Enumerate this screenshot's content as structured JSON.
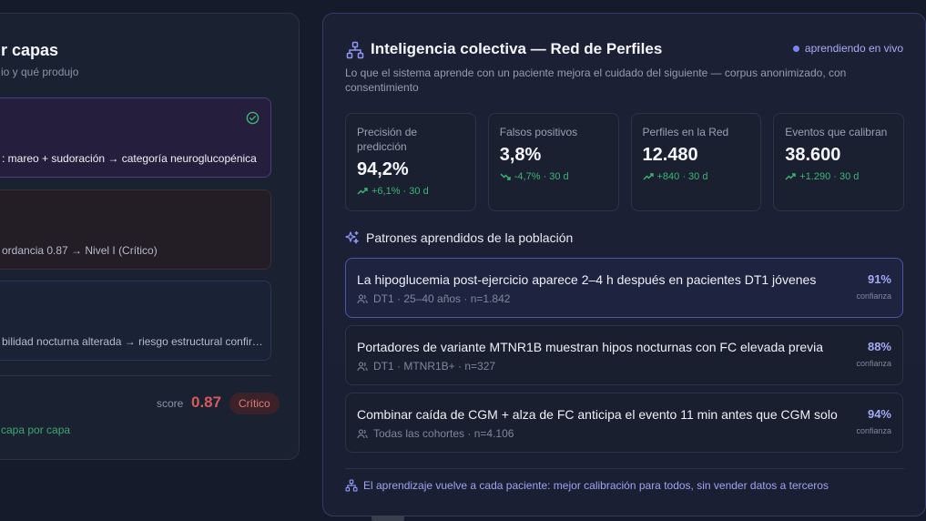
{
  "left_panel": {
    "title": "r capas",
    "subtitle": "io y qué produjo",
    "cards": [
      {
        "text": ": mareo + sudoración → categoría neuroglucopénica"
      },
      {
        "text": "ordancia 0.87 → Nivel I (Crítico)"
      },
      {
        "text": "bilidad nocturna alterada → riesgo estructural confir…"
      }
    ],
    "score_label": "score",
    "score_value": "0.87",
    "badge": "Crítico",
    "footer": "capa por capa"
  },
  "panel": {
    "title": "Inteligencia colectiva — Red de Perfiles",
    "live_label": "aprendiendo en vivo",
    "description": "Lo que el sistema aprende con un paciente mejora el cuidado del siguiente — corpus anonimizado, con consentimiento",
    "metrics": [
      {
        "label": "Precisión de predicción",
        "value": "94,2%",
        "delta": "+6,1% · 30 d",
        "trend": "up"
      },
      {
        "label": "Falsos positivos",
        "value": "3,8%",
        "delta": "-4,7% · 30 d",
        "trend": "down"
      },
      {
        "label": "Perfiles en la Red",
        "value": "12.480",
        "delta": "+840 · 30 d",
        "trend": "up"
      },
      {
        "label": "Eventos que calibran",
        "value": "38.600",
        "delta": "+1.290 · 30 d",
        "trend": "up"
      }
    ],
    "patterns_heading": "Patrones aprendidos de la población",
    "patterns": [
      {
        "text": "La hipoglucemia post-ejercicio aparece 2–4 h después en pacientes DT1 jóvenes",
        "meta": "DT1 · 25–40 años · n=1.842",
        "confidence": "91%",
        "confidence_label": "confianza"
      },
      {
        "text": "Portadores de variante MTNR1B muestran hipos nocturnas con FC elevada previa",
        "meta": "DT1 · MTNR1B+ · n=327",
        "confidence": "88%",
        "confidence_label": "confianza"
      },
      {
        "text": "Combinar caída de CGM + alza de FC anticipa el evento 11 min antes que CGM solo",
        "meta": "Todas las cohortes · n=4.106",
        "confidence": "94%",
        "confidence_label": "confianza"
      }
    ],
    "footer": "El aprendizaje vuelve a cada paciente: mejor calibración para todos, sin vender datos a terceros"
  },
  "colors": {
    "accent": "#7c84f0",
    "positive": "#3cb673",
    "critical": "#d75a5a"
  }
}
